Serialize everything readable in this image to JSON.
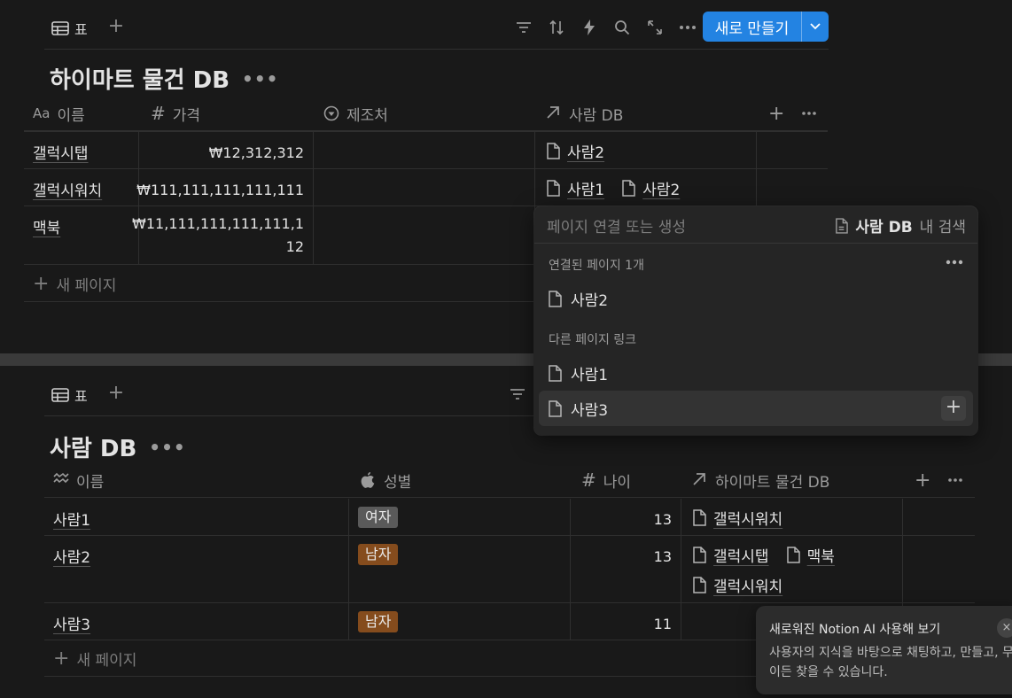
{
  "top_view": {
    "tab_label": "표",
    "new_button": "새로 만들기",
    "title": "하이마트 물건 DB",
    "columns": [
      "이름",
      "가격",
      "제조처",
      "사람 DB"
    ],
    "col_prefix_aa": "Aa",
    "rows": [
      {
        "name": "갤럭시탭",
        "price": "₩12,312,312",
        "rel": [
          "사람2"
        ]
      },
      {
        "name": "갤럭시워치",
        "price": "₩111,111,111,111,111",
        "rel": [
          "사람1",
          "사람2"
        ]
      },
      {
        "name": "맥북",
        "price_l1": "₩11,111,111,111,111,1",
        "price_l2": "12",
        "rel": []
      }
    ],
    "new_page": "새 페이지"
  },
  "popup": {
    "placeholder": "페이지 연결 또는 생성",
    "scope_db": "사람 DB",
    "scope_suffix": "내 검색",
    "linked_header": "연결된 페이지 1개",
    "linked": [
      "사람2"
    ],
    "other_header": "다른 페이지 링크",
    "others": [
      "사람1",
      "사람3"
    ]
  },
  "bottom_view": {
    "tab_label": "표",
    "title": "사람 DB",
    "columns": [
      "이름",
      "성별",
      "나이",
      "하이마트 물건 DB"
    ],
    "rows": [
      {
        "name": "사람1",
        "gender": "여자",
        "age": "13",
        "rel": [
          "갤럭시워치"
        ]
      },
      {
        "name": "사람2",
        "gender": "남자",
        "age": "13",
        "rel": [
          "갤럭시탭",
          "맥북"
        ],
        "rel2": [
          "갤럭시워치"
        ]
      },
      {
        "name": "사람3",
        "gender": "남자",
        "age": "11",
        "rel": []
      }
    ],
    "new_page": "새 페이지"
  },
  "toast": {
    "title": "새로워진 Notion AI 사용해 보기",
    "body": "사용자의 지식을 바탕으로 채팅하고, 만들고, 무엇이든 찾을 수 있습니다.",
    "close": "×"
  },
  "colors": {
    "accent": "#2383e2",
    "tag_female": "#5a5a5a",
    "tag_male": "#854c1d",
    "background": "#191919"
  }
}
